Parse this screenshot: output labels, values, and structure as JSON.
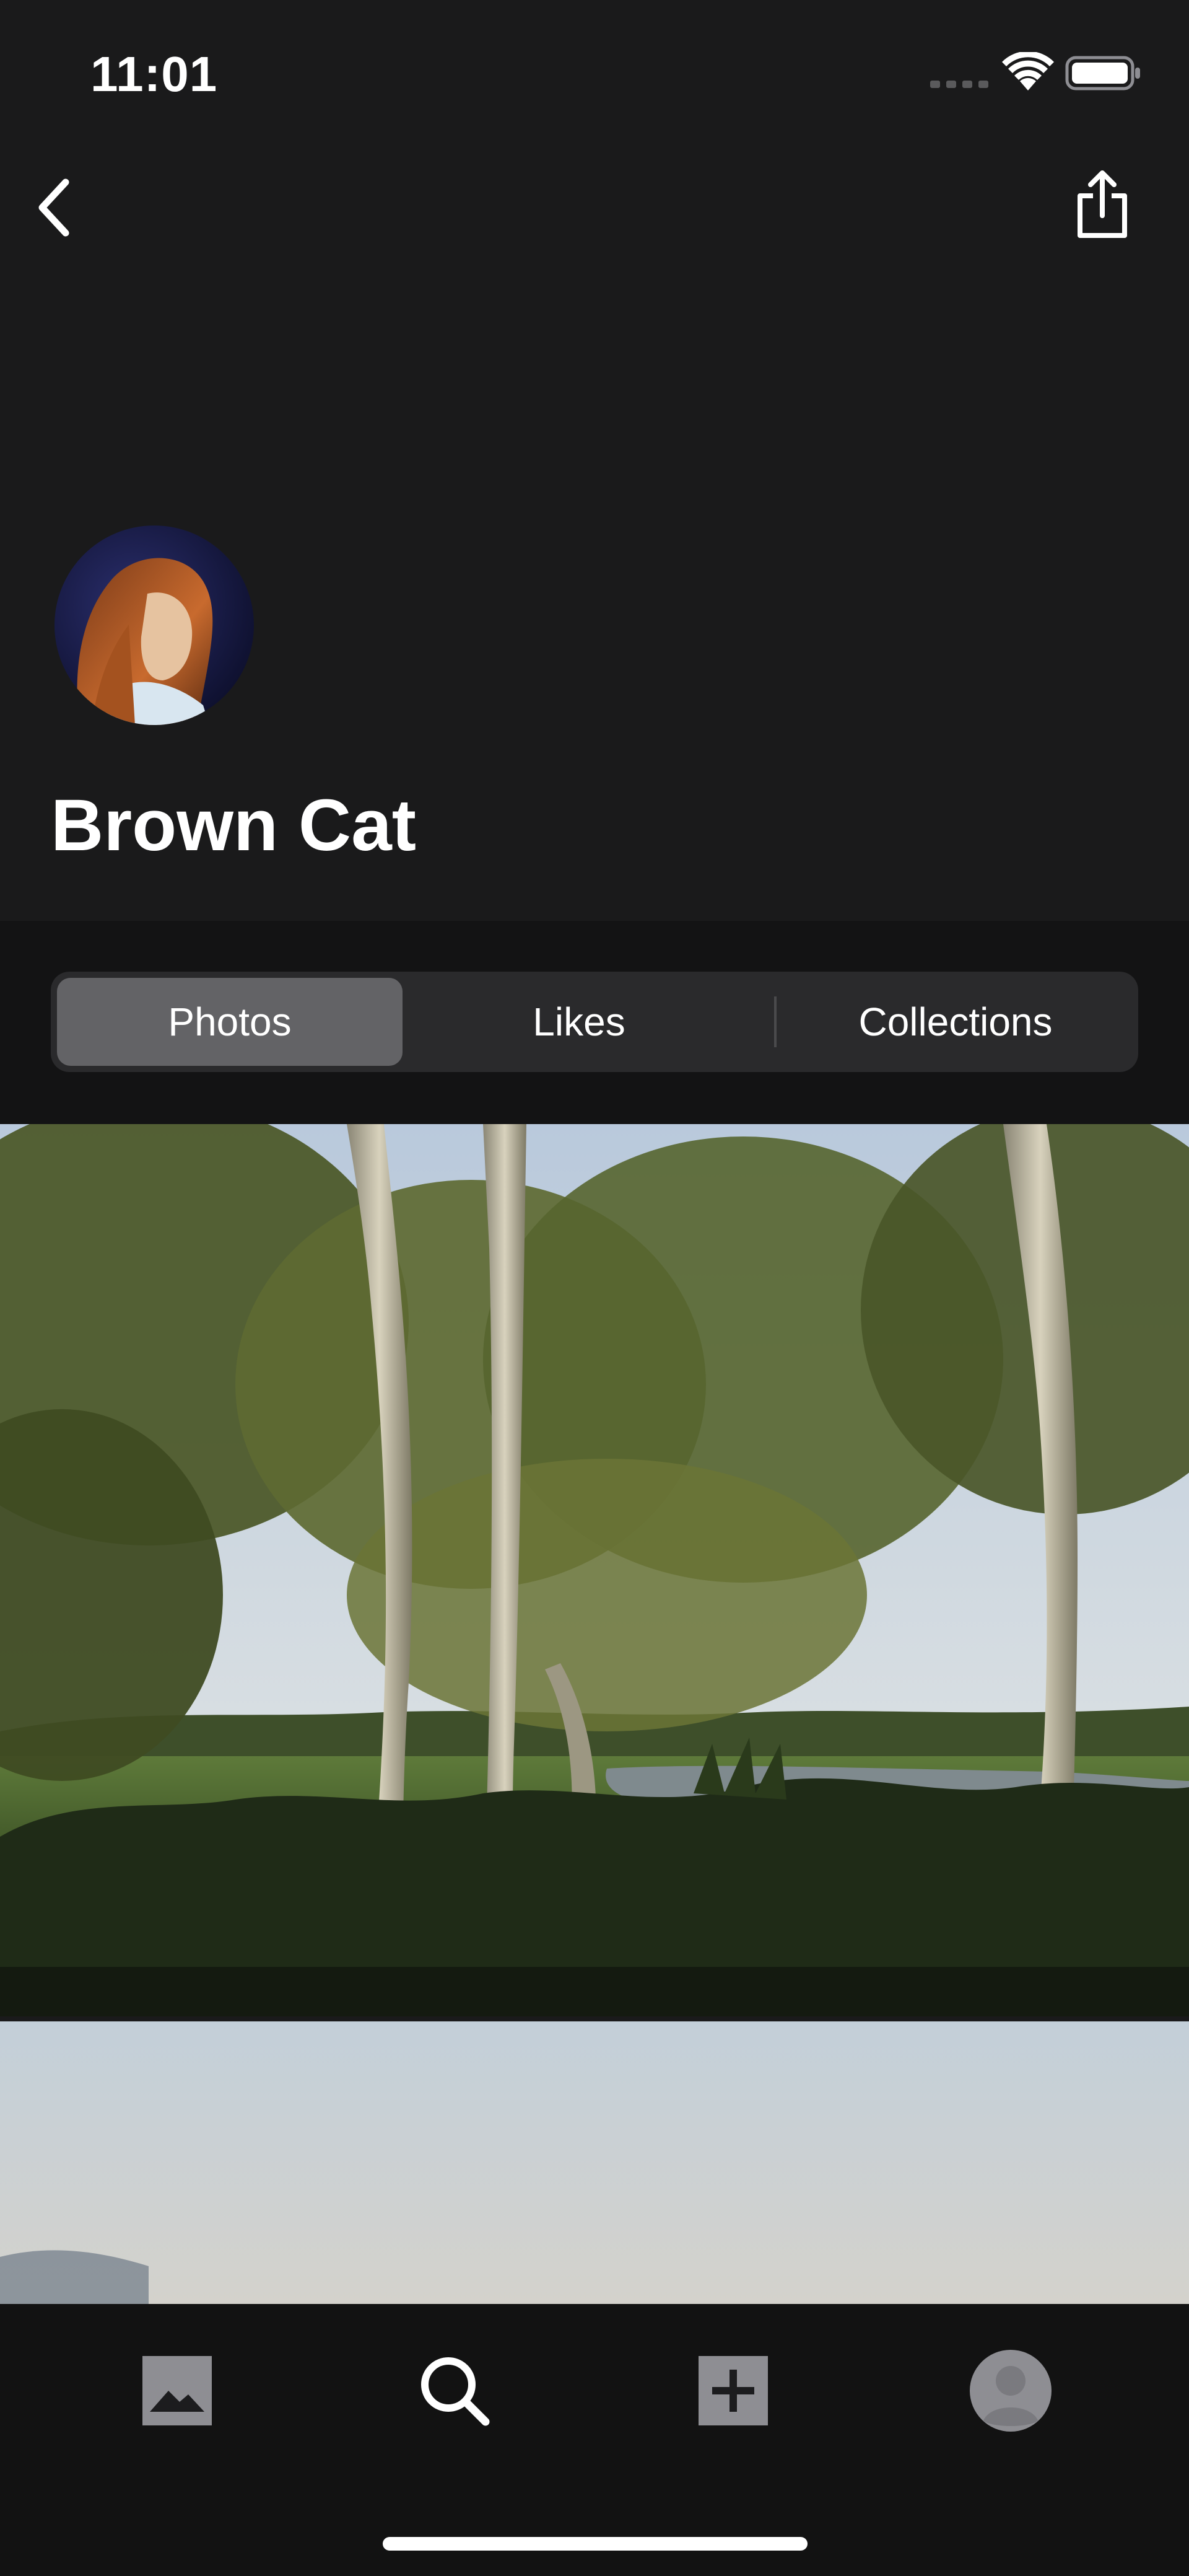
{
  "status_bar": {
    "time": "11:01",
    "signal_icon": "cellular-signal-icon",
    "wifi_icon": "wifi-icon",
    "battery_icon": "battery-icon"
  },
  "nav": {
    "back_icon": "chevron-left-icon",
    "share_icon": "share-icon"
  },
  "profile": {
    "name": "Brown Cat",
    "avatar_icon": "avatar"
  },
  "segments": {
    "items": [
      {
        "label": "Photos",
        "selected": true
      },
      {
        "label": "Likes",
        "selected": false
      },
      {
        "label": "Collections",
        "selected": false
      }
    ]
  },
  "tab_bar": {
    "items": [
      {
        "icon": "photo-icon",
        "active": false
      },
      {
        "icon": "search-icon",
        "active": true
      },
      {
        "icon": "plus-square-icon",
        "active": false
      },
      {
        "icon": "profile-avatar-icon",
        "active": false
      }
    ]
  },
  "colors": {
    "background": "#1a1a1b",
    "segment_bg": "#2a2a2c",
    "segment_selected": "#636366",
    "tab_bar_bg": "#121212",
    "icon_gray": "#8e8e93"
  }
}
